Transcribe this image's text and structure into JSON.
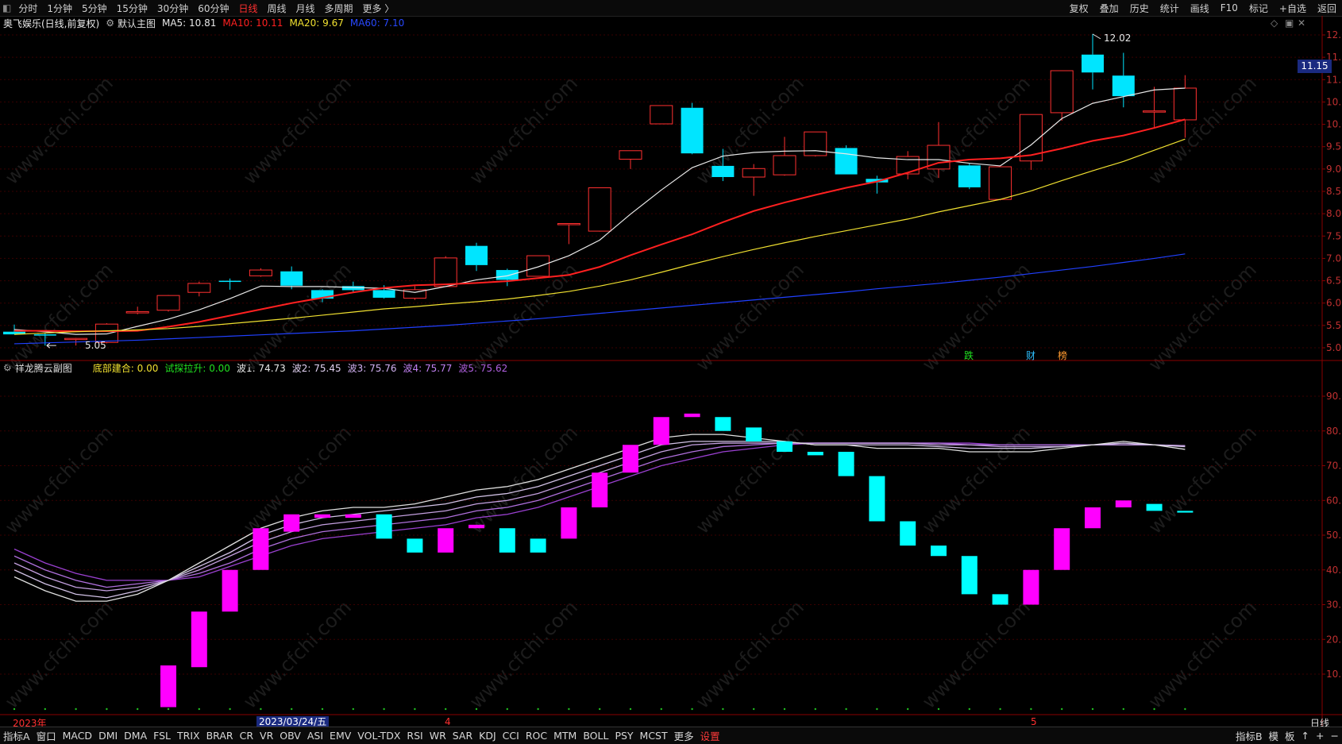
{
  "topbar": {
    "periods": [
      "分时",
      "1分钟",
      "5分钟",
      "15分钟",
      "30分钟",
      "60分钟",
      "日线",
      "周线",
      "月线",
      "多周期",
      "更多 〉"
    ],
    "active_period": "日线",
    "tools": [
      "复权",
      "叠加",
      "历史",
      "统计",
      "画线",
      "F10",
      "标记",
      "+自选",
      "返回"
    ]
  },
  "main_info": {
    "title": "奥飞娱乐(日线,前复权)",
    "chart_name": "默认主图",
    "ma5": "MA5: 10.81",
    "ma10": "MA10: 10.11",
    "ma20": "MA20: 9.67",
    "ma60": "MA60: 7.10"
  },
  "sub_info": {
    "title": "祥龙腾云副图",
    "base": "底部建合: 0.00",
    "probe": "试探拉升: 0.00",
    "w1": "波1: 74.73",
    "w2": "波2: 75.45",
    "w3": "波3: 75.76",
    "w4": "波4: 75.77",
    "w5": "波5: 75.62"
  },
  "chart_data": [
    {
      "type": "candlestick",
      "title": "奥飞娱乐(日线,前复权)",
      "y_ticks": [
        "12.00",
        "11.50",
        "11.00",
        "10.50",
        "10.00",
        "9.50",
        "9.00",
        "8.50",
        "8.00",
        "7.50",
        "7.00",
        "6.50",
        "6.00",
        "5.50",
        "5.00"
      ],
      "ylim": [
        4.8,
        12.3
      ],
      "last_price": "11.15",
      "high_label": "12.02",
      "low_label": "5.05",
      "event_marks": [
        "跌",
        "财",
        "榜"
      ],
      "candles": [
        [
          5.36,
          5.3,
          5.52,
          5.3
        ],
        [
          5.3,
          5.29,
          5.32,
          5.05
        ],
        [
          5.21,
          5.21,
          5.22,
          5.05
        ],
        [
          5.12,
          5.53,
          5.55,
          5.1
        ],
        [
          5.78,
          5.81,
          5.92,
          5.75
        ],
        [
          5.84,
          6.17,
          6.18,
          5.81
        ],
        [
          6.24,
          6.44,
          6.48,
          6.15
        ],
        [
          6.5,
          6.49,
          6.55,
          6.3
        ],
        [
          6.61,
          6.74,
          6.78,
          6.59
        ],
        [
          6.71,
          6.39,
          6.82,
          6.31
        ],
        [
          6.29,
          6.1,
          6.31,
          6.02
        ],
        [
          6.38,
          6.29,
          6.48,
          6.24
        ],
        [
          6.29,
          6.12,
          6.4,
          6.1
        ],
        [
          6.11,
          6.3,
          6.38,
          6.07
        ],
        [
          6.37,
          7.01,
          7.05,
          6.37
        ],
        [
          7.28,
          6.85,
          7.35,
          6.72
        ],
        [
          6.74,
          6.52,
          6.77,
          6.38
        ],
        [
          6.6,
          7.06,
          7.06,
          6.6
        ],
        [
          7.77,
          7.78,
          7.78,
          7.32
        ],
        [
          7.61,
          8.58,
          8.58,
          7.6
        ],
        [
          9.22,
          9.41,
          9.41,
          9.0
        ],
        [
          10.01,
          10.42,
          10.42,
          10.01
        ],
        [
          10.37,
          9.35,
          10.48,
          9.33
        ],
        [
          9.07,
          8.82,
          9.45,
          8.73
        ],
        [
          8.82,
          9.01,
          9.11,
          8.4
        ],
        [
          8.87,
          9.3,
          9.72,
          8.85
        ],
        [
          9.3,
          9.83,
          9.83,
          9.28
        ],
        [
          9.47,
          8.88,
          9.53,
          8.88
        ],
        [
          8.78,
          8.7,
          8.85,
          8.45
        ],
        [
          8.89,
          9.28,
          9.4,
          8.77
        ],
        [
          9.0,
          9.53,
          10.05,
          8.8
        ],
        [
          9.08,
          8.59,
          9.12,
          8.55
        ],
        [
          8.32,
          9.05,
          9.05,
          8.3
        ],
        [
          9.18,
          10.22,
          10.22,
          8.98
        ],
        [
          10.26,
          11.2,
          11.2,
          10.08
        ],
        [
          11.56,
          11.16,
          12.02,
          10.78
        ],
        [
          11.09,
          10.63,
          11.6,
          10.38
        ],
        [
          10.3,
          10.3,
          10.84,
          9.92
        ],
        [
          10.1,
          10.81,
          11.1,
          9.7
        ]
      ],
      "series": [
        {
          "name": "MA5",
          "color": "#e8e8e8",
          "values": [
            5.41,
            5.36,
            5.3,
            5.31,
            5.48,
            5.64,
            5.85,
            6.1,
            6.38,
            6.37,
            6.37,
            6.35,
            6.33,
            6.24,
            6.37,
            6.52,
            6.61,
            6.81,
            7.06,
            7.41,
            7.99,
            8.53,
            9.03,
            9.29,
            9.37,
            9.4,
            9.41,
            9.34,
            9.25,
            9.21,
            9.21,
            9.13,
            9.07,
            9.54,
            10.13,
            10.47,
            10.62,
            10.77,
            10.81
          ]
        },
        {
          "name": "MA10",
          "color": "#ff2020",
          "values": [
            5.38,
            5.38,
            5.37,
            5.37,
            5.38,
            5.47,
            5.58,
            5.72,
            5.86,
            6.0,
            6.12,
            6.24,
            6.34,
            6.4,
            6.42,
            6.45,
            6.49,
            6.56,
            6.63,
            6.81,
            7.07,
            7.31,
            7.54,
            7.81,
            8.06,
            8.25,
            8.42,
            8.58,
            8.72,
            8.92,
            9.14,
            9.21,
            9.24,
            9.31,
            9.46,
            9.63,
            9.75,
            9.92,
            10.11
          ]
        },
        {
          "name": "MA20",
          "color": "#f0e030",
          "values": [
            5.3,
            5.33,
            5.36,
            5.38,
            5.4,
            5.43,
            5.48,
            5.54,
            5.6,
            5.66,
            5.73,
            5.8,
            5.87,
            5.92,
            5.98,
            6.03,
            6.09,
            6.17,
            6.26,
            6.38,
            6.52,
            6.69,
            6.87,
            7.04,
            7.2,
            7.35,
            7.49,
            7.62,
            7.75,
            7.88,
            8.04,
            8.18,
            8.32,
            8.51,
            8.74,
            8.96,
            9.17,
            9.42,
            9.67
          ]
        },
        {
          "name": "MA60",
          "color": "#2040ff",
          "values": [
            5.09,
            5.11,
            5.13,
            5.15,
            5.17,
            5.2,
            5.23,
            5.26,
            5.29,
            5.32,
            5.35,
            5.38,
            5.42,
            5.46,
            5.5,
            5.55,
            5.6,
            5.65,
            5.71,
            5.77,
            5.83,
            5.89,
            5.95,
            6.01,
            6.07,
            6.13,
            6.19,
            6.25,
            6.32,
            6.38,
            6.44,
            6.51,
            6.58,
            6.66,
            6.74,
            6.82,
            6.91,
            7.0,
            7.1
          ]
        }
      ]
    },
    {
      "type": "bar",
      "title": "祥龙腾云副图",
      "y_ticks": [
        "90.00",
        "80.00",
        "70.00",
        "60.00",
        "50.00",
        "40.00",
        "30.00",
        "20.00",
        "10.00"
      ],
      "ylim": [
        0,
        100
      ],
      "bars": [
        [
          null,
          null
        ],
        [
          null,
          null
        ],
        [
          null,
          null
        ],
        [
          null,
          null
        ],
        [
          null,
          null
        ],
        [
          0.5,
          12.5
        ],
        [
          12,
          28
        ],
        [
          28,
          40
        ],
        [
          40,
          52
        ],
        [
          51,
          56
        ],
        [
          55,
          56
        ],
        [
          55,
          56
        ],
        [
          49,
          56
        ],
        [
          45,
          49
        ],
        [
          45,
          52
        ],
        [
          52,
          53
        ],
        [
          45,
          52
        ],
        [
          45,
          49
        ],
        [
          49,
          58
        ],
        [
          58,
          68
        ],
        [
          68,
          76
        ],
        [
          76,
          84
        ],
        [
          84,
          85
        ],
        [
          80,
          84
        ],
        [
          77,
          81
        ],
        [
          74,
          77
        ],
        [
          73,
          74
        ],
        [
          67,
          74
        ],
        [
          54,
          67
        ],
        [
          47,
          54
        ],
        [
          44,
          47
        ],
        [
          33,
          44
        ],
        [
          30,
          33
        ],
        [
          30,
          40
        ],
        [
          40,
          52
        ],
        [
          52,
          58
        ],
        [
          58,
          60
        ],
        [
          57,
          59
        ],
        [
          56.5,
          57
        ]
      ],
      "series": [
        {
          "name": "波1",
          "color": "#e0e0e0",
          "values": [
            38,
            34,
            31,
            31,
            33,
            37,
            42,
            47,
            52,
            55,
            57,
            58,
            58,
            59,
            61,
            63,
            64,
            66,
            69,
            72,
            75,
            78,
            79,
            79,
            78,
            77,
            76,
            76,
            75,
            75,
            75,
            74,
            74,
            74,
            75,
            76,
            77,
            76,
            74.7
          ]
        },
        {
          "name": "波2",
          "color": "#d2c2e6",
          "values": [
            40,
            36,
            33,
            32,
            34,
            37,
            41,
            45,
            50,
            53,
            55,
            56,
            57,
            58,
            59,
            61,
            62,
            64,
            67,
            70,
            73,
            76,
            77,
            77,
            77,
            77,
            76,
            76,
            76,
            76,
            75.5,
            75,
            75,
            75,
            75.5,
            76,
            76.5,
            76,
            75.45
          ]
        },
        {
          "name": "波3",
          "color": "#c4a0e0",
          "values": [
            42,
            38,
            35,
            34,
            35,
            37,
            40,
            44,
            48,
            51,
            53,
            54,
            55,
            56,
            57,
            59,
            60,
            62,
            65,
            68,
            71,
            74,
            76,
            76.5,
            76.5,
            76.5,
            76.5,
            76.5,
            76.5,
            76.5,
            76,
            76,
            75.5,
            75.5,
            75.5,
            76,
            76,
            76,
            75.76
          ]
        },
        {
          "name": "波4",
          "color": "#b070dd",
          "values": [
            44,
            40,
            37,
            35,
            36,
            37,
            39,
            42,
            46,
            49,
            51,
            52,
            53,
            54,
            55,
            57,
            58,
            60,
            63,
            66,
            69,
            72,
            74,
            75.5,
            76,
            76.5,
            76.5,
            76.5,
            76.5,
            76.5,
            76.5,
            76,
            76,
            76,
            76,
            76,
            76,
            76,
            75.77
          ]
        },
        {
          "name": "波5",
          "color": "#9a40d0",
          "values": [
            46,
            42,
            39,
            37,
            37,
            37,
            38,
            41,
            44,
            47,
            49,
            50,
            51,
            52,
            53,
            55,
            56,
            58,
            61,
            64,
            67,
            70,
            72,
            74,
            75,
            76,
            76.5,
            76.5,
            76.5,
            76.5,
            76.5,
            76.5,
            76,
            76,
            76,
            76,
            76,
            76,
            75.62
          ]
        }
      ]
    }
  ],
  "date_axis": {
    "start": "2023年",
    "cursor": "2023/03/24/五",
    "m4": "4",
    "m5": "5",
    "period": "日线"
  },
  "bottombar": {
    "items": [
      "指标A",
      "窗口",
      "MACD",
      "DMI",
      "DMA",
      "FSL",
      "TRIX",
      "BRAR",
      "CR",
      "VR",
      "OBV",
      "ASI",
      "EMV",
      "VOL-TDX",
      "RSI",
      "WR",
      "SAR",
      "KDJ",
      "CCI",
      "ROC",
      "MTM",
      "BOLL",
      "PSY",
      "MCST",
      "更多",
      "设置"
    ],
    "right_items": [
      "指标B",
      "模",
      "板",
      "↑",
      "+",
      "−"
    ]
  },
  "watermark": "www.cfchi.com",
  "colors": {
    "up": "#ff3030",
    "down": "#00e5ff",
    "bar_up": "#ff00ff",
    "bar_down": "#00ffff",
    "grid": "#3a0000"
  }
}
